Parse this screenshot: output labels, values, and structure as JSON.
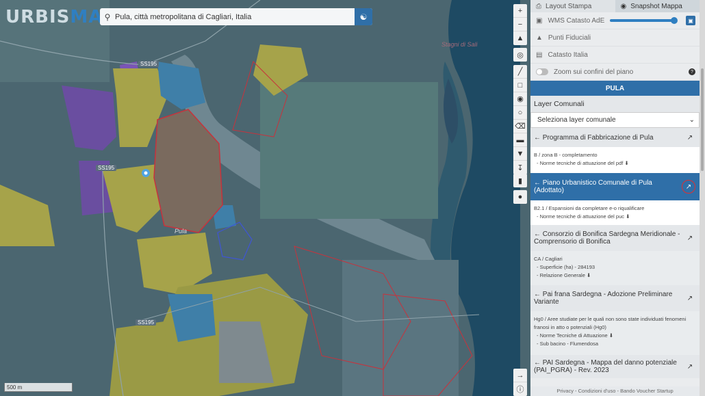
{
  "app": {
    "logo_a": "URBIS",
    "logo_b": "MAP"
  },
  "search": {
    "value": "Pula, città metropolitana di Cagliari, Italia",
    "icon": "search-icon",
    "globe_icon": "globe-icon"
  },
  "map_labels": {
    "road1": "SS195",
    "road2": "SS195",
    "road3": "SS195",
    "place": "Pula",
    "water": "Stagni di Sali",
    "scale": "500 m"
  },
  "colors": {
    "accent": "#2f6fa8",
    "purple": "#7a55b5",
    "yellow": "#cbbb4a",
    "blue": "#3f8fbf",
    "red": "#c8323c"
  },
  "panel": {
    "tab_layout": "Layout Stampa",
    "tab_snapshot": "Snapshot Mappa",
    "wms": "WMS Catasto AdE",
    "fiduciali": "Punti Fiduciali",
    "catasto": "Catasto Italia",
    "zoom_confini": "Zoom sui confini del piano",
    "help": "?",
    "comune": "PULA",
    "layer_comunali": "Layer Comunali",
    "select_layer": "Seleziona layer comunale",
    "plans": [
      {
        "title": "← Programma di Fabbricazione di Pula",
        "details": [
          "B / zona B - completamento",
          "- Norme tecniche di attuazione del pdf ⬇"
        ]
      },
      {
        "title": "← Piano Urbanistico Comunale di Pula (Adottato)",
        "details": [
          "B2.1 / Espansioni da completare e-o riqualificare",
          "- Norme tecniche di attuazione del puc ⬇"
        ]
      },
      {
        "title": "← Consorzio di Bonifica Sardegna Meridionale - Comprensorio di Bonifica",
        "details": [
          "CA / Cagliari",
          "- Superficie (ha) - 284193",
          "- Relazione Generale ⬇"
        ]
      },
      {
        "title": "← Pai frana Sardegna - Adozione Preliminare Variante",
        "details": [
          "Hg0 / Aree studiate per le quali non sono state individuati fenomeni franosi in atto o potenziali (Hg0)",
          "- Norme Tecniche di Attuazione ⬇",
          "- Sub bacino - Flumendosa"
        ]
      },
      {
        "title": "← PAI Sardegna - Mappa del danno potenziale (PAI_PGRA) - Rev. 2023",
        "details": []
      }
    ],
    "footer": "Privacy - Condizioni d'uso - Bando Voucher Startup"
  }
}
